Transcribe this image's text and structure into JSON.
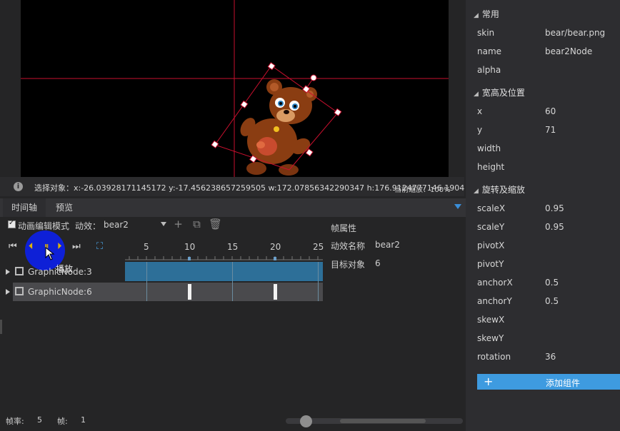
{
  "stage": {
    "selection_info": "选择对象：x:-26.03928171145172 y:-17.456238657259505  w:172.07856342290347 h:176.9124777146 1904",
    "zoom": "当前缩放：100%"
  },
  "tabs": [
    "时间轴",
    "预览"
  ],
  "timeline": {
    "mode_label": "动画编辑模式",
    "anim_label": "动效：",
    "anim_name": "bear2",
    "ruler_ticks": [
      "5",
      "10",
      "15",
      "20",
      "25"
    ],
    "tooltip": "播放",
    "layers": [
      {
        "name": "GraphicNode:3"
      },
      {
        "name": "GraphicNode:6"
      }
    ],
    "keyframes": [
      10,
      20
    ]
  },
  "frame_props": {
    "title": "帧属性",
    "anim_label": "动效名称",
    "anim_value": "bear2",
    "target_label": "目标对象",
    "target_value": "6"
  },
  "inspector": {
    "sections": {
      "common": "常用",
      "size_pos": "宽高及位置",
      "rot_scale": "旋转及缩放"
    },
    "common": [
      {
        "name": "skin",
        "value": "bear/bear.png"
      },
      {
        "name": "name",
        "value": "bear2Node"
      },
      {
        "name": "alpha",
        "value": ""
      }
    ],
    "size_pos": [
      {
        "name": "x",
        "value": "60"
      },
      {
        "name": "y",
        "value": "71"
      },
      {
        "name": "width",
        "value": ""
      },
      {
        "name": "height",
        "value": ""
      }
    ],
    "rot_scale": [
      {
        "name": "scaleX",
        "value": "0.95"
      },
      {
        "name": "scaleY",
        "value": "0.95"
      },
      {
        "name": "pivotX",
        "value": ""
      },
      {
        "name": "pivotY",
        "value": ""
      },
      {
        "name": "anchorX",
        "value": "0.5"
      },
      {
        "name": "anchorY",
        "value": "0.5"
      },
      {
        "name": "skewX",
        "value": ""
      },
      {
        "name": "skewY",
        "value": ""
      },
      {
        "name": "rotation",
        "value": "36"
      }
    ],
    "add_component": "添加组件"
  },
  "footer": {
    "fps_label": "帧率:",
    "fps_value": "5",
    "frame_label": "帧:",
    "frame_value": "1"
  },
  "colors": {
    "accent": "#3e9be0",
    "track": "#2d6f98",
    "hover": "#0d20e0",
    "guide": "#c8102e"
  }
}
